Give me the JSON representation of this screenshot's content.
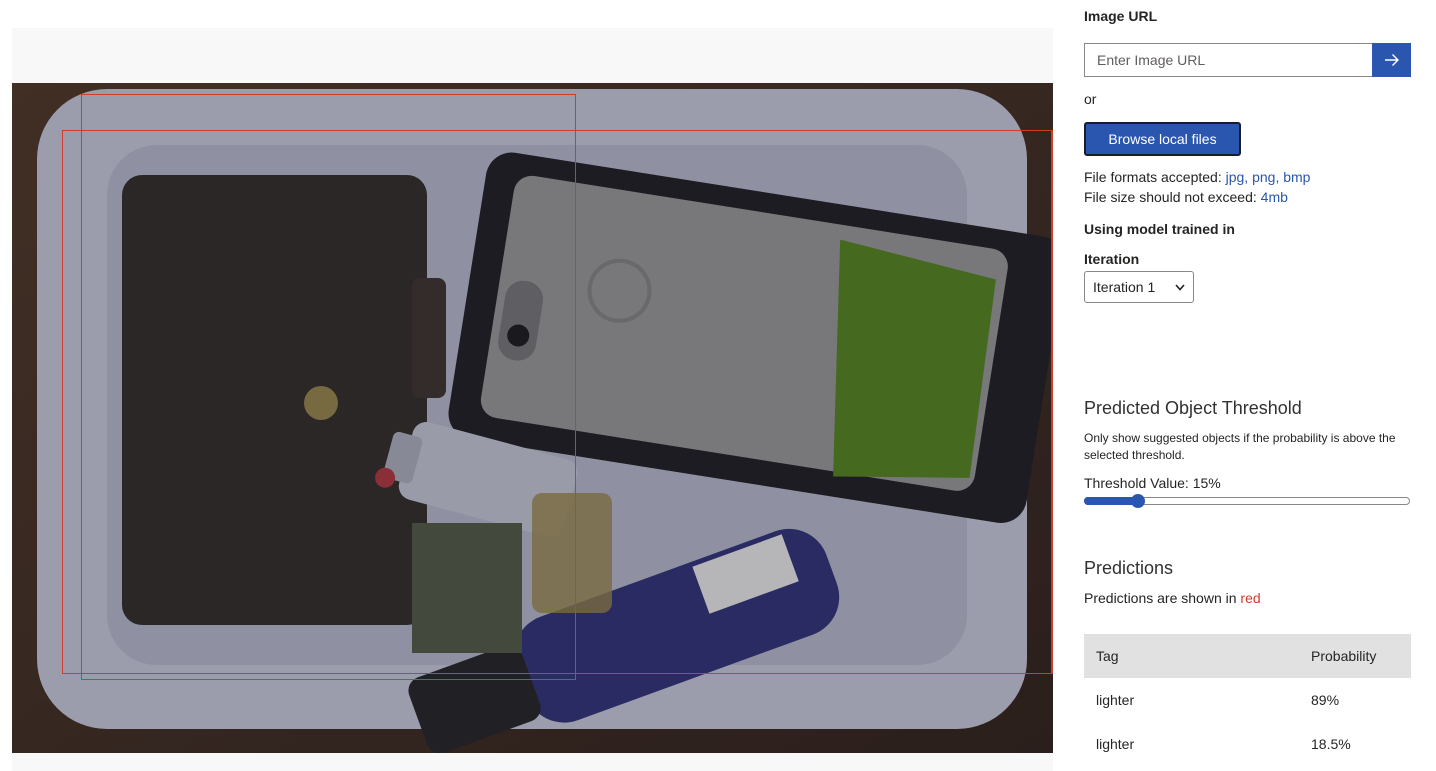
{
  "image_url": {
    "label": "Image URL",
    "placeholder": "Enter Image URL"
  },
  "or_text": "or",
  "browse_label": "Browse local files",
  "file_formats": {
    "prefix": "File formats accepted: ",
    "value": "jpg, png, bmp"
  },
  "file_size": {
    "prefix": "File size should not exceed: ",
    "value": "4mb"
  },
  "model_label": "Using model trained in",
  "iteration": {
    "label": "Iteration",
    "selected": "Iteration 1"
  },
  "threshold": {
    "title": "Predicted Object Threshold",
    "description": "Only show suggested objects if the probability is above the selected threshold.",
    "value_label": "Threshold Value: 15%",
    "value_percent": 15
  },
  "predictions": {
    "title": "Predictions",
    "desc_prefix": "Predictions are shown in ",
    "desc_color_word": "red",
    "columns": [
      "Tag",
      "Probability"
    ],
    "rows": [
      {
        "tag": "lighter",
        "probability": "89%"
      },
      {
        "tag": "lighter",
        "probability": "18.5%"
      }
    ]
  },
  "colors": {
    "accent": "#2b56b0",
    "prediction": "#d13c2a"
  }
}
